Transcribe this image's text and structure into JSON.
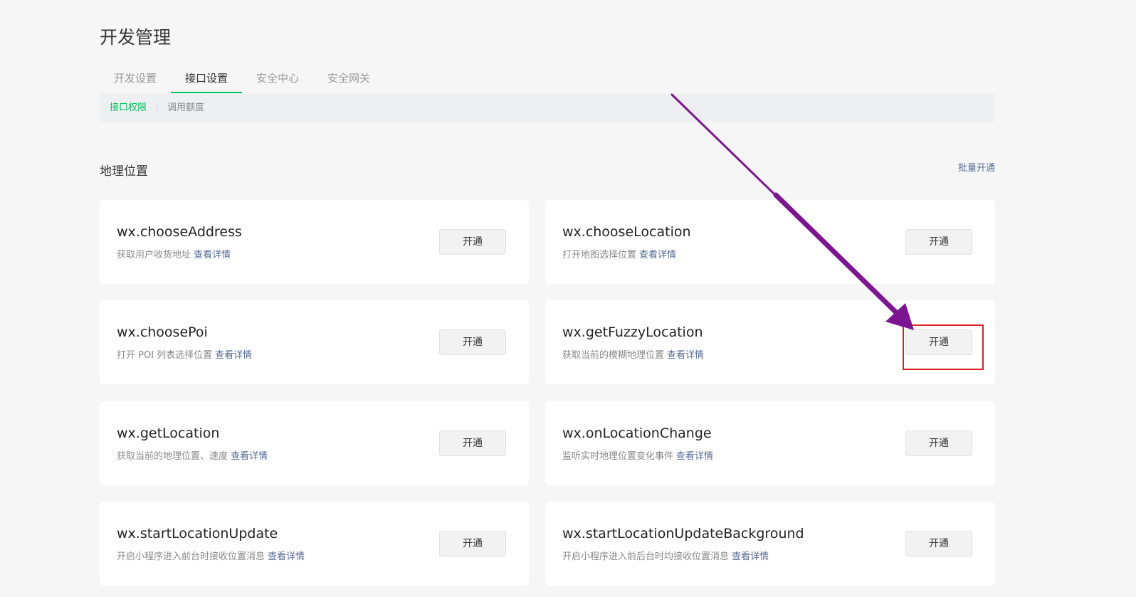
{
  "page": {
    "title": "开发管理"
  },
  "tabs": [
    {
      "label": "开发设置",
      "active": false
    },
    {
      "label": "接口设置",
      "active": true
    },
    {
      "label": "安全中心",
      "active": false
    },
    {
      "label": "安全网关",
      "active": false
    }
  ],
  "subtabs": [
    {
      "label": "接口权限",
      "active": true
    },
    {
      "label": "调用额度",
      "active": false
    }
  ],
  "section": {
    "title": "地理位置",
    "batch_label": "批量开通"
  },
  "detail_label": "查看详情",
  "open_label": "开通",
  "apis": [
    {
      "name": "wx.chooseAddress",
      "desc": "获取用户收货地址"
    },
    {
      "name": "wx.chooseLocation",
      "desc": "打开地图选择位置"
    },
    {
      "name": "wx.choosePoi",
      "desc": "打开 POI 列表选择位置"
    },
    {
      "name": "wx.getFuzzyLocation",
      "desc": "获取当前的模糊地理位置"
    },
    {
      "name": "wx.getLocation",
      "desc": "获取当前的地理位置、速度"
    },
    {
      "name": "wx.onLocationChange",
      "desc": "监听实时地理位置变化事件"
    },
    {
      "name": "wx.startLocationUpdate",
      "desc": "开启小程序进入前台时接收位置消息"
    },
    {
      "name": "wx.startLocationUpdateBackground",
      "desc": "开启小程序进入前后台时均接收位置消息"
    }
  ],
  "colors": {
    "accent_green": "#07c160",
    "link_blue": "#576b95",
    "annotation_arrow": "#7b1590",
    "annotation_box": "#e02020"
  }
}
